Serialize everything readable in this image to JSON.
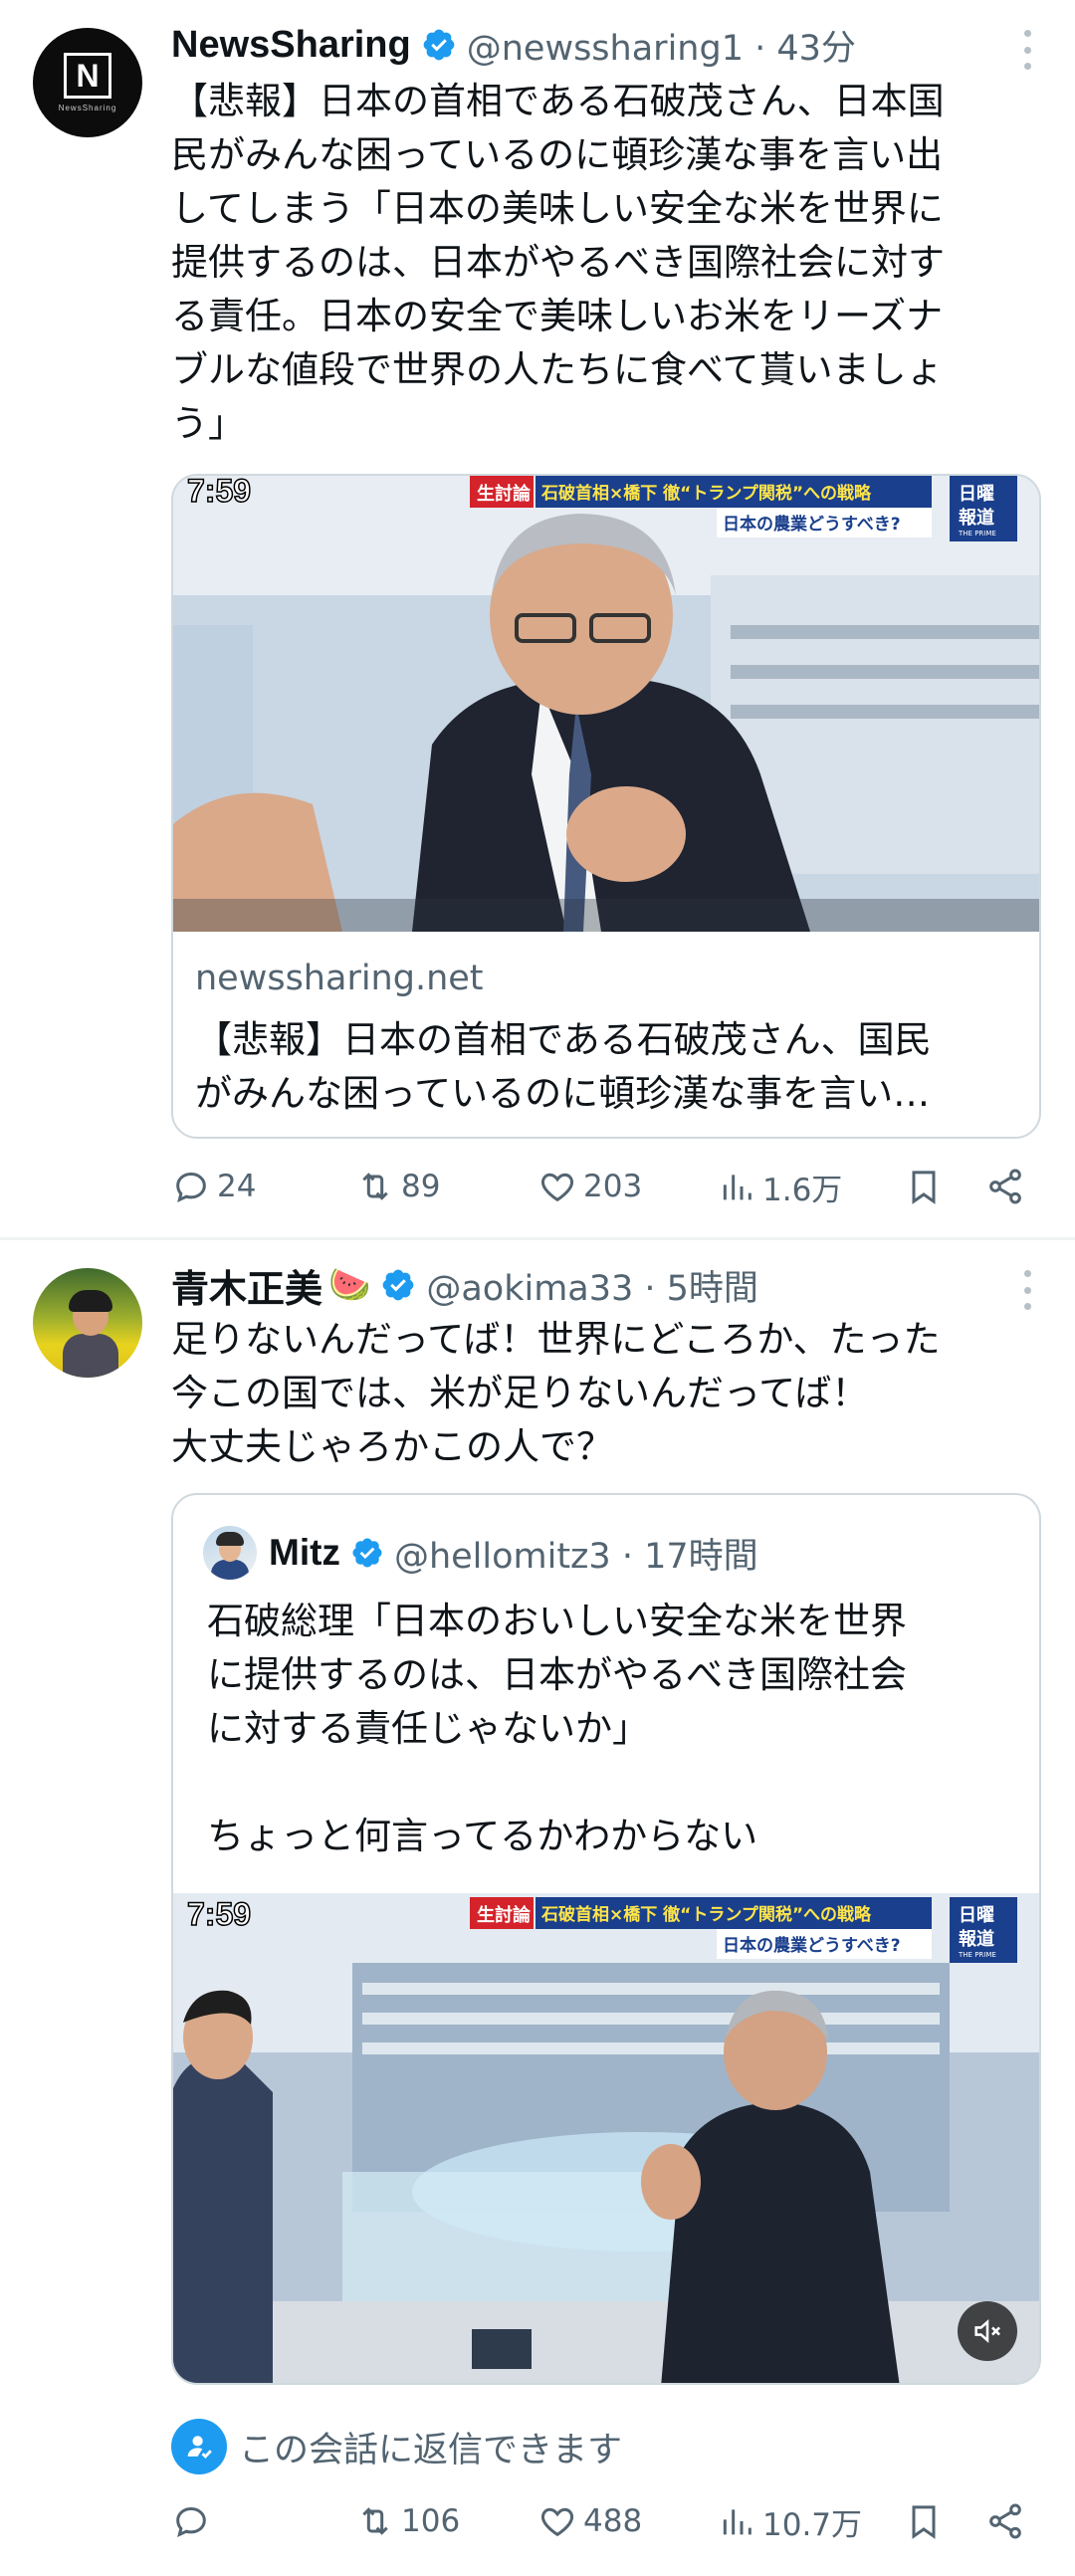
{
  "colors": {
    "accent": "#1d9bf0",
    "secondary_text": "#536471",
    "primary_text": "#0f1419",
    "border": "#cfd9de"
  },
  "tweet1": {
    "avatar_letter": "N",
    "avatar_caption": "NewsSharing",
    "name": "NewsSharing",
    "handle_time": "@newssharing1 · 43分",
    "text": "【悲報】日本の首相である石破茂さん、日本国\n民がみんな困っているのに頓珍漢な事を言い出\nしてしまう「日本の美味しい安全な米を世界に\n提供するのは、日本がやるべき国際社会に対す\nる責任。日本の安全で美味しいお米をリーズナ\nブルな値段で世界の人たちに食べて貰いましょ\nう」",
    "card": {
      "domain": "newssharing.net",
      "title_line1": "【悲報】日本の首相である石破茂さん、国民",
      "title_line2": "がみんな困っているのに頓珍漢な事を言い…",
      "image": {
        "clock": "7:59",
        "banner_tag": "生討論",
        "banner_main": "石破首相×橋下 徹“トランプ関税”への戦略",
        "banner_sub": "日本の農業どうすべき?",
        "logo_top": "日曜",
        "logo_bottom": "報道",
        "logo_small": "THE PRIME"
      }
    },
    "actions": {
      "replies": "24",
      "reposts": "89",
      "likes": "203",
      "views": "1.6万"
    }
  },
  "tweet2": {
    "name": "青木正美",
    "name_emoji": "🍉",
    "handle_time": "@aokima33 · 5時間",
    "text": "足りないんだってば！世界にどころか、たった\n今この国では、米が足りないんだってば！\n大丈夫じゃろかこの人で？",
    "quote": {
      "name": "Mitz",
      "handle_time": "@hellomitz3 · 17時間",
      "text": "石破総理「日本のおいしい安全な米を世界\nに提供するのは、日本がやるべき国際社会\nに対する責任じゃないか」\n\nちょっと何言ってるかわからない",
      "image": {
        "clock": "7:59",
        "banner_tag": "生討論",
        "banner_main": "石破首相×橋下 徹“トランプ関税”への戦略",
        "banner_sub": "日本の農業どうすべき?",
        "logo_top": "日曜",
        "logo_bottom": "報道",
        "logo_small": "THE PRIME"
      }
    },
    "reply_note": "この会話に返信できます",
    "actions": {
      "reposts": "106",
      "likes": "488",
      "views": "10.7万"
    }
  }
}
